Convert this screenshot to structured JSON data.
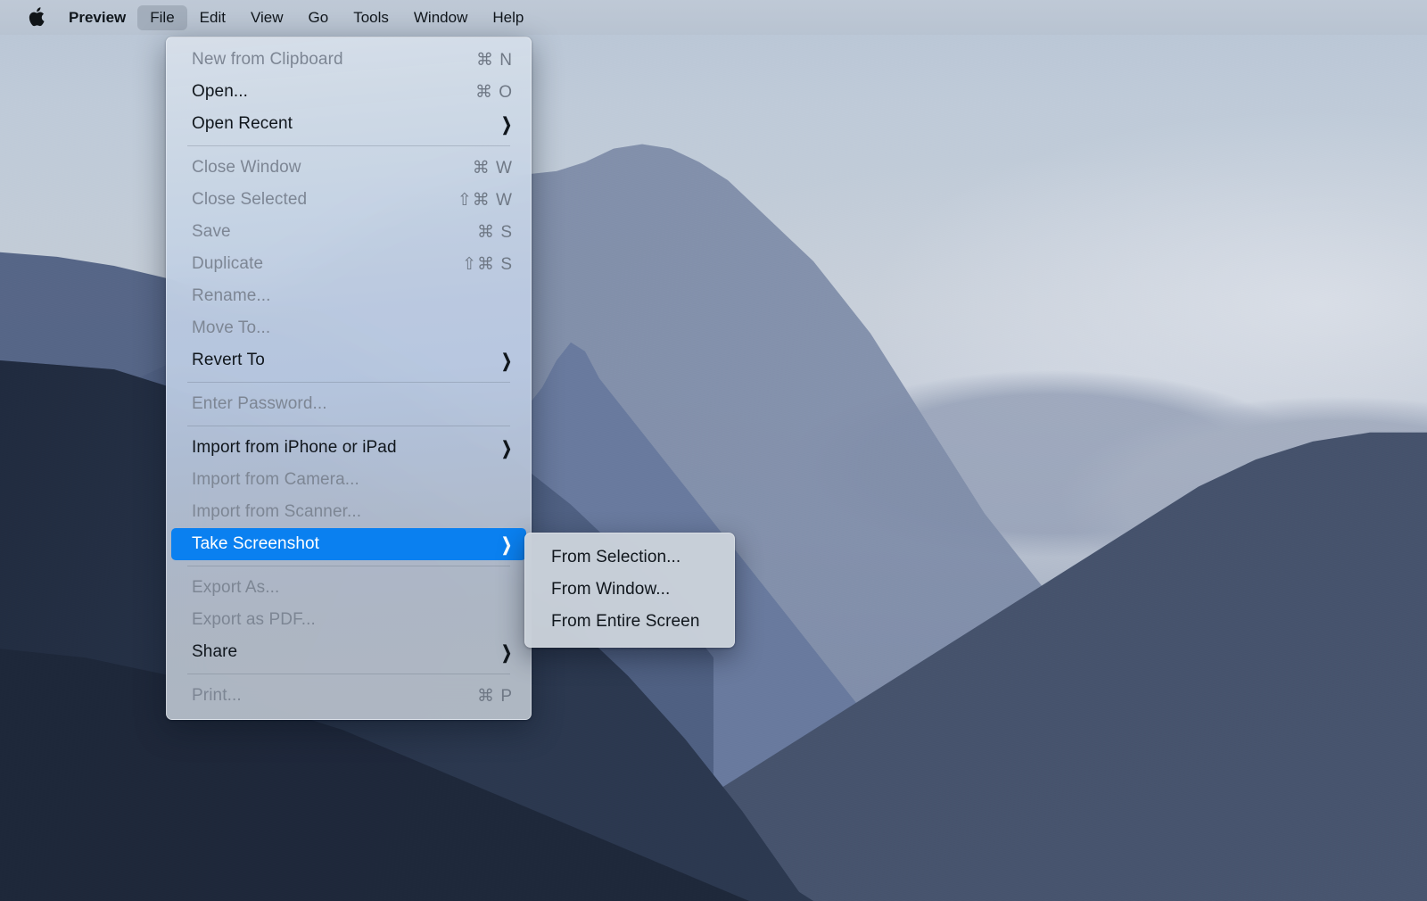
{
  "menubar": {
    "apple_icon": "apple-logo-icon",
    "app_name": "Preview",
    "items": [
      {
        "label": "File",
        "active": true
      },
      {
        "label": "Edit",
        "active": false
      },
      {
        "label": "View",
        "active": false
      },
      {
        "label": "Go",
        "active": false
      },
      {
        "label": "Tools",
        "active": false
      },
      {
        "label": "Window",
        "active": false
      },
      {
        "label": "Help",
        "active": false
      }
    ]
  },
  "file_menu": {
    "title": "File",
    "items": [
      {
        "type": "item",
        "label": "New from Clipboard",
        "shortcut": "⌘ N",
        "state": "disabled"
      },
      {
        "type": "item",
        "label": "Open...",
        "shortcut": "⌘ O",
        "state": "enabled"
      },
      {
        "type": "item",
        "label": "Open Recent",
        "shortcut": "",
        "state": "enabled",
        "submenu": true
      },
      {
        "type": "separator"
      },
      {
        "type": "item",
        "label": "Close Window",
        "shortcut": "⌘ W",
        "state": "disabled"
      },
      {
        "type": "item",
        "label": "Close Selected",
        "shortcut": "⇧⌘ W",
        "state": "disabled"
      },
      {
        "type": "item",
        "label": "Save",
        "shortcut": "⌘ S",
        "state": "disabled"
      },
      {
        "type": "item",
        "label": "Duplicate",
        "shortcut": "⇧⌘ S",
        "state": "disabled"
      },
      {
        "type": "item",
        "label": "Rename...",
        "shortcut": "",
        "state": "disabled"
      },
      {
        "type": "item",
        "label": "Move To...",
        "shortcut": "",
        "state": "disabled"
      },
      {
        "type": "item",
        "label": "Revert To",
        "shortcut": "",
        "state": "enabled",
        "submenu": true
      },
      {
        "type": "separator"
      },
      {
        "type": "item",
        "label": "Enter Password...",
        "shortcut": "",
        "state": "disabled"
      },
      {
        "type": "separator"
      },
      {
        "type": "item",
        "label": "Import from iPhone or iPad",
        "shortcut": "",
        "state": "enabled",
        "submenu": true
      },
      {
        "type": "item",
        "label": "Import from Camera...",
        "shortcut": "",
        "state": "disabled"
      },
      {
        "type": "item",
        "label": "Import from Scanner...",
        "shortcut": "",
        "state": "disabled"
      },
      {
        "type": "item",
        "label": "Take Screenshot",
        "shortcut": "",
        "state": "selected",
        "submenu": true
      },
      {
        "type": "separator"
      },
      {
        "type": "item",
        "label": "Export As...",
        "shortcut": "",
        "state": "disabled"
      },
      {
        "type": "item",
        "label": "Export as PDF...",
        "shortcut": "",
        "state": "disabled"
      },
      {
        "type": "item",
        "label": "Share",
        "shortcut": "",
        "state": "enabled",
        "submenu": true
      },
      {
        "type": "separator"
      },
      {
        "type": "item",
        "label": "Print...",
        "shortcut": "⌘ P",
        "state": "disabled"
      }
    ]
  },
  "screenshot_submenu": {
    "parent": "Take Screenshot",
    "items": [
      {
        "type": "item",
        "label": "From Selection...",
        "shortcut": "",
        "state": "enabled"
      },
      {
        "type": "item",
        "label": "From Window...",
        "shortcut": "",
        "state": "enabled"
      },
      {
        "type": "item",
        "label": "From Entire Screen",
        "shortcut": "",
        "state": "enabled"
      }
    ]
  },
  "desktop": {
    "wallpaper_name": "hazy-blue-mountain-ridges",
    "colors": {
      "menubar_bg": "#bfc9d6",
      "menu_bg": "#c0cde0",
      "highlight_blue": "#0a80f0",
      "disabled_text": "#7d8694",
      "enabled_text": "#10161c",
      "sky_top": "#b9c6d6",
      "ridge_far": "#9fa9bd",
      "ridge_mid": "#8a96af",
      "foreground_dark": "#2d3a52",
      "foreground_darkest": "#1d2739"
    }
  }
}
